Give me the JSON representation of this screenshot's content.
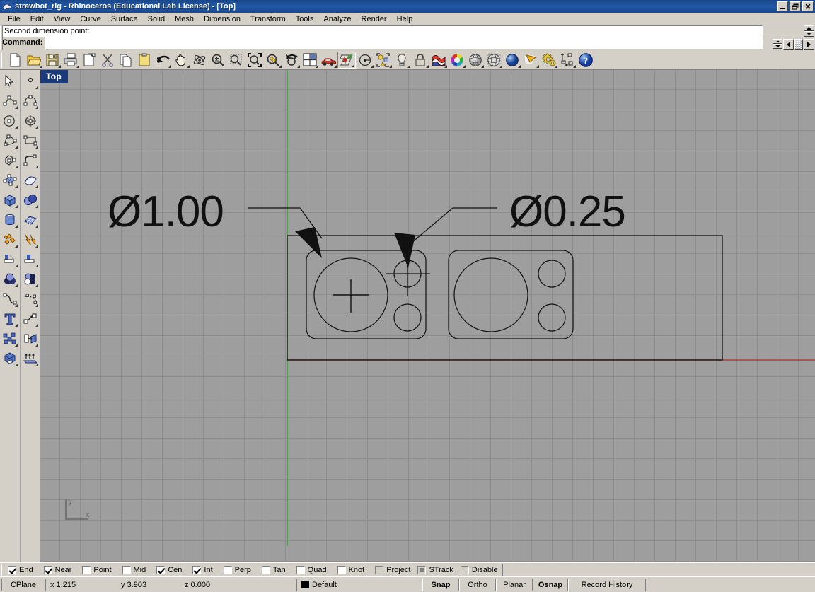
{
  "window": {
    "title": "strawbot_rig - Rhinoceros (Educational Lab License) - [Top]",
    "app_icon": "rhino-icon",
    "minimize_label": "_",
    "restore_label": "❐",
    "close_label": "✕"
  },
  "menu": {
    "items": [
      {
        "label": "File"
      },
      {
        "label": "Edit"
      },
      {
        "label": "View"
      },
      {
        "label": "Curve"
      },
      {
        "label": "Surface"
      },
      {
        "label": "Solid"
      },
      {
        "label": "Mesh"
      },
      {
        "label": "Dimension"
      },
      {
        "label": "Transform"
      },
      {
        "label": "Tools"
      },
      {
        "label": "Analyze"
      },
      {
        "label": "Render"
      },
      {
        "label": "Help"
      }
    ]
  },
  "command": {
    "history_line": "Second dimension point:",
    "prompt_label": "Command:",
    "input_value": "",
    "input_placeholder": ""
  },
  "toolbar": {
    "buttons": [
      {
        "name": "new-file-icon",
        "tip": "New"
      },
      {
        "name": "open-file-icon",
        "tip": "Open"
      },
      {
        "name": "save-file-icon",
        "tip": "Save"
      },
      {
        "name": "print-icon",
        "tip": "Print"
      },
      {
        "name": "cut-copy-page-icon",
        "tip": "Copy to clipboard"
      },
      {
        "name": "scissors-cut-icon",
        "tip": "Cut"
      },
      {
        "name": "copy-pages-icon",
        "tip": "Copy"
      },
      {
        "name": "paste-clipboard-icon",
        "tip": "Paste"
      },
      {
        "name": "undo-arrow-icon",
        "tip": "Undo"
      },
      {
        "name": "pan-hand-icon",
        "tip": "Pan"
      },
      {
        "name": "rotate-view-icon",
        "tip": "Rotate view"
      },
      {
        "name": "zoom-in-out-icon",
        "tip": "Zoom in/out"
      },
      {
        "name": "zoom-window-icon",
        "tip": "Zoom window"
      },
      {
        "name": "zoom-extents-icon",
        "tip": "Zoom extents"
      },
      {
        "name": "zoom-selected-icon",
        "tip": "Zoom selected"
      },
      {
        "name": "undo-view-icon",
        "tip": "Undo view change"
      },
      {
        "name": "four-viewport-icon",
        "tip": "4 viewports"
      },
      {
        "name": "car-render-icon",
        "tip": "Render"
      },
      {
        "name": "shade-grid-icon",
        "tip": "Shaded viewport"
      },
      {
        "name": "properties-circle-icon",
        "tip": "Properties"
      },
      {
        "name": "layer-objects-icon",
        "tip": "Layers"
      },
      {
        "name": "light-bulb-icon",
        "tip": "Lights"
      },
      {
        "name": "lock-icon",
        "tip": "Lock object"
      },
      {
        "name": "material-icon",
        "tip": "Material"
      },
      {
        "name": "color-wheel-icon",
        "tip": "Color"
      },
      {
        "name": "ghosted-sphere-icon",
        "tip": "Ghosted display"
      },
      {
        "name": "wireframe-sphere-icon",
        "tip": "Wireframe display"
      },
      {
        "name": "shaded-sphere-icon",
        "tip": "Shaded display"
      },
      {
        "name": "render-preview-icon",
        "tip": "Rendered display"
      },
      {
        "name": "options-gears-icon",
        "tip": "Options"
      },
      {
        "name": "dimension-tool-icon",
        "tip": "Dimensions"
      },
      {
        "name": "help-question-icon",
        "tip": "Help"
      }
    ]
  },
  "sidebar": {
    "left_column": [
      {
        "name": "select-arrow-icon"
      },
      {
        "name": "polyline-icon"
      },
      {
        "name": "circle-icon"
      },
      {
        "name": "curve-interp-icon"
      },
      {
        "name": "polygon-icon"
      },
      {
        "name": "surface-corner-points-icon"
      },
      {
        "name": "box-solid-icon"
      },
      {
        "name": "cylinder-solid-icon"
      },
      {
        "name": "boolean-union-icon"
      },
      {
        "name": "trim-icon"
      },
      {
        "name": "offset-sphere-icon"
      },
      {
        "name": "fillet-curve-icon"
      },
      {
        "name": "text-tool-icon"
      },
      {
        "name": "group-objects-icon"
      },
      {
        "name": "cap-solid-icon"
      }
    ],
    "right_column": [
      {
        "name": "point-icon"
      },
      {
        "name": "curve-control-points-icon"
      },
      {
        "name": "ellipse-icon"
      },
      {
        "name": "rectangle-icon"
      },
      {
        "name": "arc-icon"
      },
      {
        "name": "surface-edge-curves-icon"
      },
      {
        "name": "sphere-solid-icon"
      },
      {
        "name": "mesh-plane-icon"
      },
      {
        "name": "explode-icon"
      },
      {
        "name": "split-icon"
      },
      {
        "name": "boolean-difference-icon"
      },
      {
        "name": "blend-curve-icon"
      },
      {
        "name": "scale-icon"
      },
      {
        "name": "copy-object-icon"
      },
      {
        "name": "extrude-icon"
      }
    ]
  },
  "viewport": {
    "label": "Top",
    "axis_gizmo": {
      "x_label": "x",
      "y_label": "y"
    },
    "grid": {
      "background": "#9e9e9e",
      "minor_line_color": "#8d8d8d",
      "major_line_color": "#7e7e7e",
      "x_axis_color": "#b03a3a",
      "y_axis_color": "#3f9b3f",
      "minor_spacing_px": 29,
      "major_every": 5
    },
    "geometry_color": "#111111",
    "annotations": [
      {
        "name": "diameter-dim-large",
        "text": "Ø1.00",
        "points_to": "large-circle-left-plate"
      },
      {
        "name": "diameter-dim-small",
        "text": "Ø0.25",
        "points_to": "small-circle-left-plate"
      }
    ],
    "objects": [
      {
        "name": "outer-boundary-rectangle",
        "type": "rectangle"
      },
      {
        "name": "left-plate",
        "type": "rounded-rectangle"
      },
      {
        "name": "left-plate-large-circle",
        "type": "circle"
      },
      {
        "name": "left-plate-large-circle-crosshair",
        "type": "crosshair"
      },
      {
        "name": "left-plate-small-circle-top",
        "type": "circle"
      },
      {
        "name": "left-plate-small-circle-top-crosshair",
        "type": "crosshair"
      },
      {
        "name": "left-plate-small-circle-bottom",
        "type": "circle"
      },
      {
        "name": "right-plate",
        "type": "rounded-rectangle"
      },
      {
        "name": "right-plate-large-circle",
        "type": "circle"
      },
      {
        "name": "right-plate-small-circle-top",
        "type": "circle"
      },
      {
        "name": "right-plate-small-circle-bottom",
        "type": "circle"
      }
    ]
  },
  "osnap": {
    "items": [
      {
        "label": "End",
        "checked": true,
        "style": "check"
      },
      {
        "label": "Near",
        "checked": true,
        "style": "check"
      },
      {
        "label": "Point",
        "checked": false,
        "style": "check"
      },
      {
        "label": "Mid",
        "checked": false,
        "style": "check"
      },
      {
        "label": "Cen",
        "checked": true,
        "style": "check"
      },
      {
        "label": "Int",
        "checked": true,
        "style": "check"
      },
      {
        "label": "Perp",
        "checked": false,
        "style": "check"
      },
      {
        "label": "Tan",
        "checked": false,
        "style": "check"
      },
      {
        "label": "Quad",
        "checked": false,
        "style": "check"
      },
      {
        "label": "Knot",
        "checked": false,
        "style": "check"
      },
      {
        "label": "Project",
        "checked": false,
        "style": "gray"
      },
      {
        "label": "STrack",
        "checked": true,
        "style": "gray"
      },
      {
        "label": "Disable",
        "checked": false,
        "style": "gray"
      }
    ]
  },
  "statusbar": {
    "cplane_label": "CPlane",
    "coords": {
      "x": "x 1.215",
      "y": "y 3.903",
      "z": "z 0.000"
    },
    "layer": {
      "name": "Default",
      "color": "#000000"
    },
    "toggles": [
      {
        "label": "Snap",
        "active": true
      },
      {
        "label": "Ortho",
        "active": false
      },
      {
        "label": "Planar",
        "active": false
      },
      {
        "label": "Osnap",
        "active": true
      },
      {
        "label": "Record History",
        "active": false
      }
    ]
  }
}
